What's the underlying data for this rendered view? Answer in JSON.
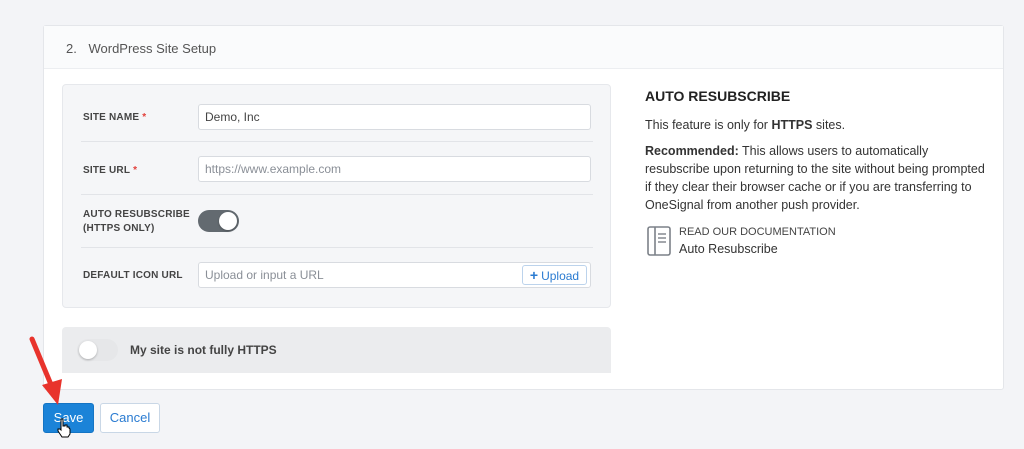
{
  "section": {
    "number": "2.",
    "title": "WordPress Site Setup"
  },
  "form": {
    "site_name": {
      "label": "SITE NAME",
      "required_mark": "*",
      "value": "Demo, Inc"
    },
    "site_url": {
      "label": "SITE URL",
      "required_mark": "*",
      "placeholder": "https://www.example.com"
    },
    "auto_resubscribe": {
      "label_line1": "AUTO RESUBSCRIBE",
      "label_line2": "(HTTPS ONLY)",
      "enabled": true
    },
    "default_icon": {
      "label": "DEFAULT ICON URL",
      "placeholder": "Upload or input a URL",
      "upload_plus": "+",
      "upload_label": "Upload"
    }
  },
  "https_toggle": {
    "label": "My site is not fully HTTPS",
    "enabled": false
  },
  "help": {
    "title": "AUTO RESUBSCRIBE",
    "line1_prefix": "This feature is only for ",
    "line1_bold": "HTTPS",
    "line1_suffix": " sites.",
    "recommended_label": "Recommended:",
    "recommended_text": " This allows users to automatically resubscribe upon returning to the site without being prompted if they clear their browser cache or if you are transferring to OneSignal from another push provider.",
    "doc_link_title": "READ OUR DOCUMENTATION",
    "doc_link_sub": "Auto Resubscribe"
  },
  "actions": {
    "save_label": "Save",
    "cancel_label": "Cancel"
  },
  "colors": {
    "primary": "#1b83d8",
    "required": "#e2403c",
    "toggle_on": "#636a70",
    "annotation_arrow": "#e8332c"
  },
  "icons": {
    "doc": "document-icon",
    "plus": "plus-icon",
    "arrow": "arrow-annotation-icon",
    "cursor": "hand-cursor-icon"
  }
}
